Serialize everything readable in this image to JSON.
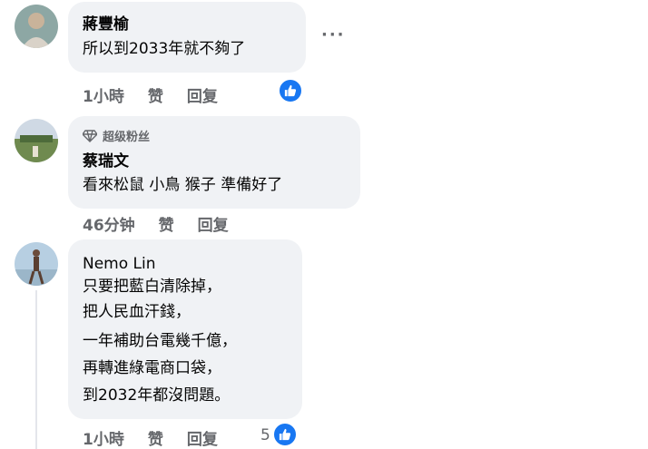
{
  "comments": [
    {
      "author": "蔣豐榆",
      "lines": [
        "所以到2033年就不夠了"
      ],
      "time": "1小時",
      "like_label": "赞",
      "reply_label": "回复",
      "reactions": ""
    },
    {
      "badge": "超级粉丝",
      "author": "蔡瑞文",
      "lines": [
        "看來松鼠 小鳥 猴子 準備好了"
      ],
      "time": "46分钟",
      "like_label": "赞",
      "reply_label": "回复"
    },
    {
      "author": "Nemo Lin",
      "lines": [
        "只要把藍白清除掉，",
        "把人民血汗錢，",
        "一年補助台電幾千億，",
        "再轉進綠電商口袋，",
        "到2032年都沒問題。"
      ],
      "time": "1小時",
      "like_label": "赞",
      "reply_label": "回复",
      "reactions": "5"
    }
  ],
  "colors": {
    "bubble": "#f0f2f5",
    "meta": "#65676b",
    "accent": "#1877f2"
  },
  "icons": {
    "more": "more-options-icon",
    "like": "like-thumb-icon",
    "fan": "diamond-icon"
  }
}
